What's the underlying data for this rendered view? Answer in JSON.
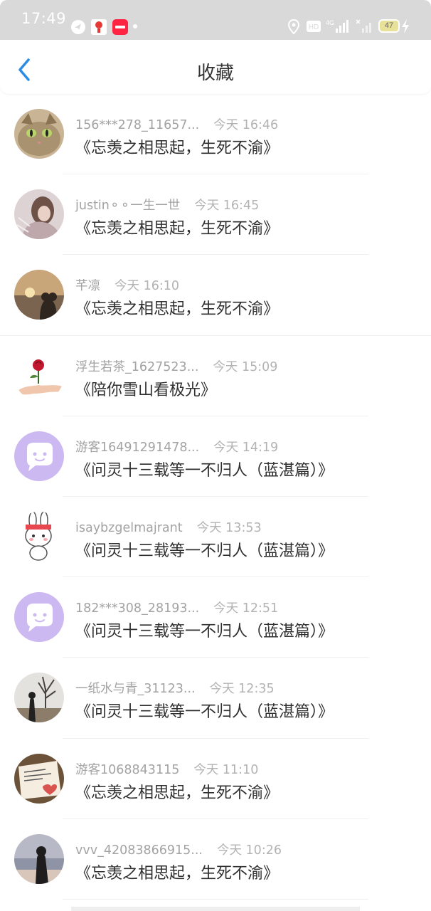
{
  "status_bar": {
    "time": "17:49",
    "battery": "47",
    "network": "4G"
  },
  "header": {
    "title": "收藏",
    "back_icon": "chevron-left-icon",
    "accent": "#2b8ce6"
  },
  "favorites": [
    {
      "user": "156***278_11657...",
      "time": "今天 16:46",
      "work": "《忘羡之相思起，生死不渝》",
      "avatar": "cat-avatar"
    },
    {
      "user": "justin⚬⚬一生一世",
      "time": "今天 16:45",
      "work": "《忘羡之相思起，生死不渝》",
      "avatar": "girl-avatar"
    },
    {
      "user": "芊凛",
      "time": "今天 16:10",
      "work": "《忘羡之相思起，生死不渝》",
      "avatar": "sunset-avatar"
    },
    {
      "user": "浮生若茶_1627523...",
      "time": "今天 15:09",
      "work": "《陪你雪山看极光》",
      "avatar": "rose-avatar"
    },
    {
      "user": "游客16491291478...",
      "time": "今天 14:19",
      "work": "《问灵十三载等一不归人（蓝湛篇）》",
      "avatar": "default-avatar"
    },
    {
      "user": "isaybzgelmajrant",
      "time": "今天 13:53",
      "work": "《问灵十三载等一不归人（蓝湛篇）》",
      "avatar": "bunny-avatar"
    },
    {
      "user": "182***308_28193...",
      "time": "今天 12:51",
      "work": "《问灵十三载等一不归人（蓝湛篇）》",
      "avatar": "default-avatar"
    },
    {
      "user": "一纸水与青_31123...",
      "time": "今天 12:35",
      "work": "《问灵十三载等一不归人（蓝湛篇）》",
      "avatar": "tree-avatar"
    },
    {
      "user": "游客1068843115",
      "time": "今天 11:10",
      "work": "《忘羡之相思起，生死不渝》",
      "avatar": "note-avatar"
    },
    {
      "user": "vvv_42083866915...",
      "time": "今天 10:26",
      "work": "《忘羡之相思起，生死不渝》",
      "avatar": "beach-avatar"
    }
  ]
}
